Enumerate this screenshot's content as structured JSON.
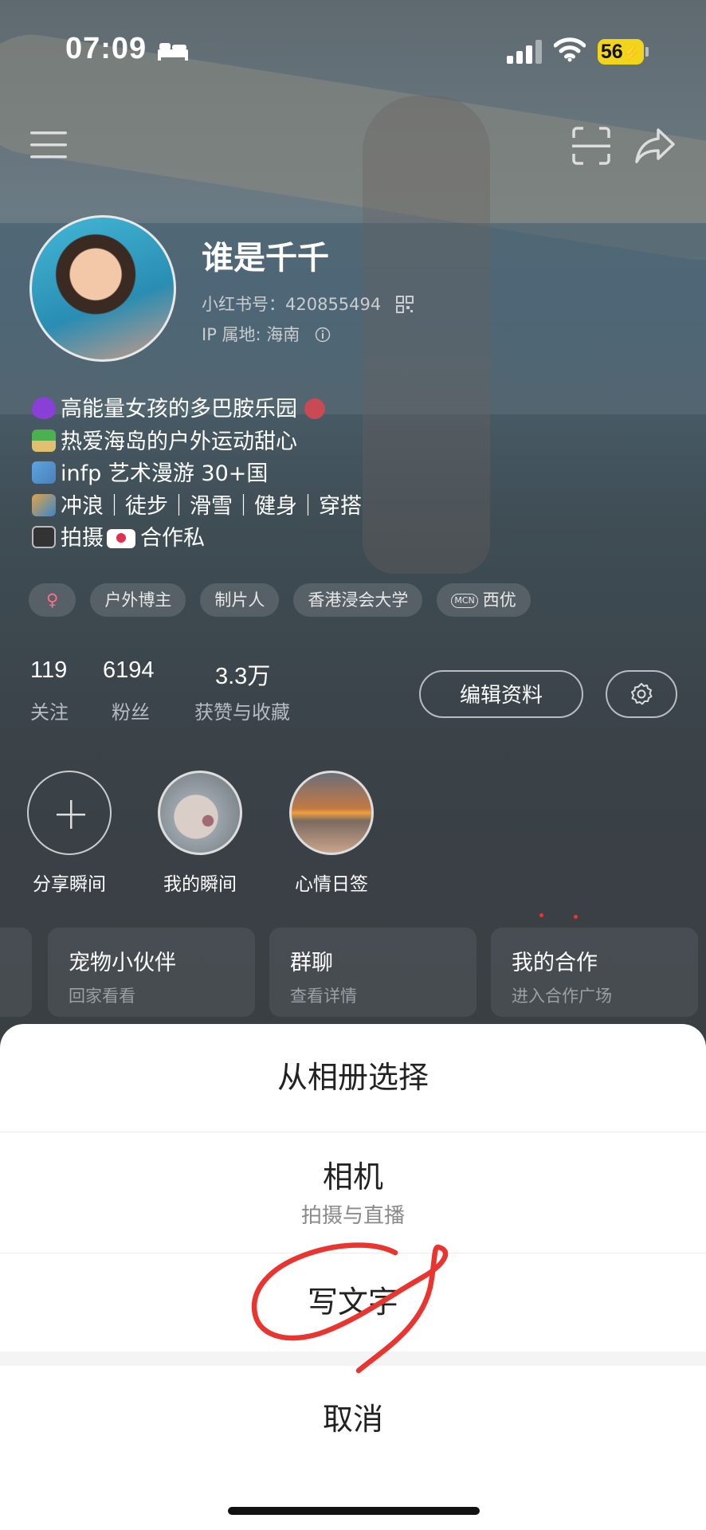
{
  "status_bar": {
    "time": "07:09",
    "battery": "56"
  },
  "profile": {
    "nickname": "谁是千千",
    "red_id": "小红书号：420855494",
    "ip_location": "IP 属地: 海南",
    "bio_lines": [
      "高能量女孩的多巴胺乐园",
      "热爱海岛的户外运动甜心",
      "infp 艺术漫游 30+国",
      "冲浪｜徒步｜滑雪｜健身｜穿搭",
      "拍摄",
      "合作私"
    ],
    "tags": [
      "♀",
      "户外博主",
      "制片人",
      "香港浸会大学",
      "MCN",
      "西优"
    ]
  },
  "stats": {
    "following": {
      "value": "119",
      "label": "关注"
    },
    "followers": {
      "value": "6194",
      "label": "粉丝"
    },
    "likes": {
      "value": "3.3万",
      "label": "获赞与收藏"
    }
  },
  "buttons": {
    "edit_profile": "编辑资料"
  },
  "moments": [
    {
      "label": "分享瞬间"
    },
    {
      "label": "我的瞬间"
    },
    {
      "label": "心情日签"
    }
  ],
  "cards": [
    {
      "title": "宠物小伙伴",
      "subtitle": "回家看看"
    },
    {
      "title": "群聊",
      "subtitle": "查看详情"
    },
    {
      "title": "我的合作",
      "subtitle": "进入合作广场"
    }
  ],
  "action_sheet": {
    "album": "从相册选择",
    "camera": "相机",
    "camera_sub": "拍摄与直播",
    "write_text": "写文字",
    "cancel": "取消"
  },
  "colors": {
    "annotation": "#e8352f",
    "battery": "#f2d51a"
  }
}
